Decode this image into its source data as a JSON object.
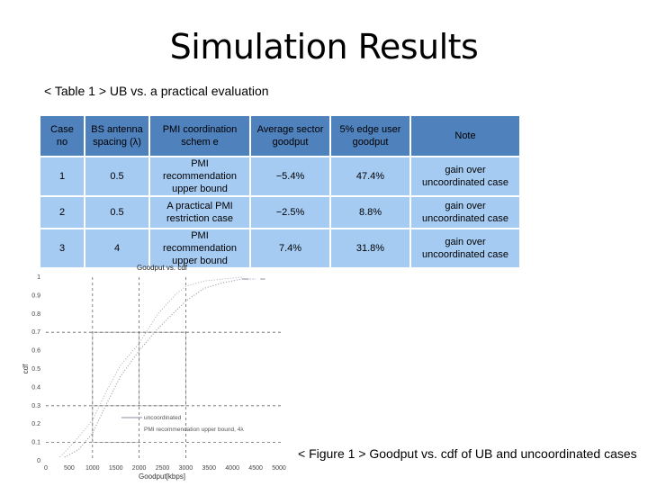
{
  "slide": {
    "title": "Simulation Results",
    "table_caption": "< Table 1 > UB vs. a practical evaluation",
    "figure_caption": "< Figure 1 > Goodput vs. cdf of UB and uncoordinated cases"
  },
  "table": {
    "header": [
      [
        "Case",
        "no"
      ],
      [
        "BS antenna",
        "spacing (λ)"
      ],
      [
        "PMI coordination",
        "schem e"
      ],
      [
        "Average sector",
        "goodput"
      ],
      [
        "5% edge user",
        "goodput"
      ],
      [
        "Note"
      ]
    ],
    "rows": [
      {
        "case": "1",
        "spacing": "0.5",
        "scheme": [
          "PMI recommendation",
          "upper bound"
        ],
        "avg": "−5.4%",
        "edge": "47.4%",
        "note": [
          "gain over",
          "uncoordinated case"
        ]
      },
      {
        "case": "2",
        "spacing": "0.5",
        "scheme": [
          "A practical PMI",
          "restriction case"
        ],
        "avg": "−2.5%",
        "edge": "8.8%",
        "note": [
          "gain over",
          "uncoordinated case"
        ]
      },
      {
        "case": "3",
        "spacing": "4",
        "scheme": [
          "PMI recommendation",
          "upper bound"
        ],
        "avg": "7.4%",
        "edge": "31.8%",
        "note": [
          "gain over",
          "uncoordinated case"
        ]
      }
    ],
    "colors": {
      "header_bg": "#4f81bd",
      "cell_bg": "#a6cbf2"
    }
  },
  "chart_data": {
    "type": "line",
    "title": "Goodput vs. cdf",
    "xlabel": "Goodput[kbps]",
    "ylabel": "cdf",
    "xlim": [
      0,
      5000
    ],
    "ylim": [
      0,
      1
    ],
    "xticks": [
      0,
      500,
      1000,
      1500,
      2000,
      2500,
      3000,
      3500,
      4000,
      4500,
      5000
    ],
    "yticks": [
      0,
      0.1,
      0.2,
      0.3,
      0.4,
      0.5,
      0.6,
      0.7,
      0.8,
      0.9,
      1
    ],
    "xtick_labels": [
      "0",
      "500",
      "1000",
      "1500",
      "2000",
      "2500",
      "3000",
      "3500",
      "4000",
      "4500",
      "5000"
    ],
    "ytick_labels": [
      "0",
      "0.1",
      "0.2",
      "0.3",
      "0.4",
      "0.5",
      "0.6",
      "0.7",
      "0.8",
      "0.9",
      "1"
    ],
    "grid": {
      "dashed_x": [
        1000,
        2000,
        3000
      ],
      "dashed_y": [
        0.1,
        0.3,
        0.7
      ]
    },
    "legend": [
      "uncoordinated",
      "PMI recommendation upper bound, 4λ"
    ],
    "legend_position": "lower-center",
    "series": [
      {
        "name": "uncoordinated",
        "x": [
          400,
          700,
          1000,
          1300,
          1600,
          2000,
          2400,
          2800,
          3000,
          3400,
          3800,
          4200,
          4500
        ],
        "y": [
          0.02,
          0.06,
          0.15,
          0.31,
          0.46,
          0.6,
          0.72,
          0.82,
          0.87,
          0.94,
          0.97,
          0.99,
          0.99
        ]
      },
      {
        "name": "PMI recommendation upper bound, 4λ",
        "x": [
          300,
          600,
          1000,
          1300,
          1600,
          2000,
          2400,
          2800,
          3000,
          3400,
          3800,
          4200
        ],
        "y": [
          0.02,
          0.1,
          0.22,
          0.38,
          0.52,
          0.64,
          0.8,
          0.91,
          0.95,
          0.98,
          0.99,
          1.0
        ]
      }
    ]
  }
}
